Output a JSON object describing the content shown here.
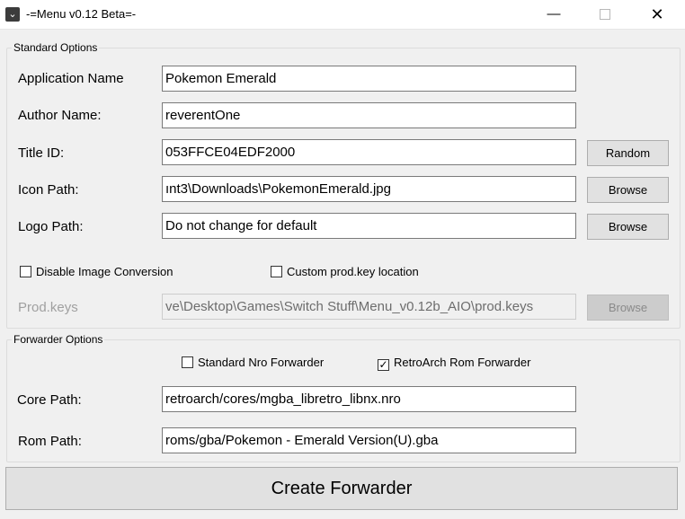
{
  "window": {
    "title": "-=Menu v0.12 Beta=-",
    "icon": "app-icon",
    "minimize_glyph": "—",
    "close_glyph": "✕"
  },
  "standard": {
    "legend": "Standard Options",
    "app_name_label": "Application Name",
    "app_name_value": "Pokemon Emerald",
    "author_label": "Author Name:",
    "author_value": "reverentOne",
    "title_id_label": "Title ID:",
    "title_id_value": "053FFCE04EDF2000",
    "random_button": "Random",
    "icon_path_label": "Icon Path:",
    "icon_path_value": "ınt3\\Downloads\\PokemonEmerald.jpg",
    "icon_browse": "Browse",
    "logo_path_label": "Logo Path:",
    "logo_path_value": "Do not change for default",
    "logo_browse": "Browse",
    "disable_conversion_label": "Disable Image Conversion",
    "disable_conversion_checked": false,
    "custom_prodkey_label": "Custom prod.key location",
    "custom_prodkey_checked": false,
    "prodkeys_label": "Prod.keys",
    "prodkeys_value": "ve\\Desktop\\Games\\Switch Stuff\\Menu_v0.12b_AIO\\prod.keys",
    "prodkeys_browse": "Browse"
  },
  "forwarder": {
    "legend": "Forwarder Options",
    "nro_label": "Standard Nro Forwarder",
    "nro_checked": false,
    "retroarch_label": "RetroArch Rom Forwarder",
    "retroarch_checked": true,
    "check_glyph": "✓",
    "core_label": "Core Path:",
    "core_value": "retroarch/cores/mgba_libretro_libnx.nro",
    "rom_label": "Rom Path:",
    "rom_value": "roms/gba/Pokemon - Emerald Version(U).gba"
  },
  "create_button": "Create Forwarder"
}
